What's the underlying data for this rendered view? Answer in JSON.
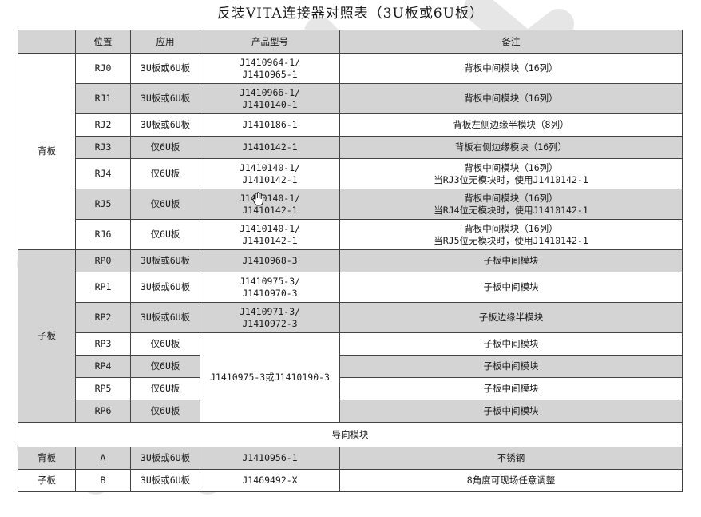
{
  "title": "反装VITA连接器对照表（3U板或6U板）",
  "headers": {
    "group": "",
    "pos": "位置",
    "app": "应用",
    "model": "产品型号",
    "note": "备注"
  },
  "groups": {
    "back": "背板",
    "daughter": "子板"
  },
  "rows": [
    {
      "pos": "RJ0",
      "app": "3U板或6U板",
      "model1": "J1410964-1/",
      "model2": "J1410965-1",
      "note1": "背板中间模块（16列）",
      "note2": ""
    },
    {
      "pos": "RJ1",
      "app": "3U板或6U板",
      "model1": "J1410966-1/",
      "model2": "J1410140-1",
      "note1": "背板中间模块（16列）",
      "note2": ""
    },
    {
      "pos": "RJ2",
      "app": "3U板或6U板",
      "model1": "J1410186-1",
      "model2": "",
      "note1": "背板左侧边缘半模块（8列）",
      "note2": ""
    },
    {
      "pos": "RJ3",
      "app": "仅6U板",
      "model1": "J1410142-1",
      "model2": "",
      "note1": "背板右侧边缘模块（16列）",
      "note2": ""
    },
    {
      "pos": "RJ4",
      "app": "仅6U板",
      "model1": "J1410140-1/",
      "model2": "J1410142-1",
      "note1": "背板中间模块（16列）",
      "note2": "当RJ3位无模块时，使用J1410142-1"
    },
    {
      "pos": "RJ5",
      "app": "仅6U板",
      "model1": "J1410140-1/",
      "model2": "J1410142-1",
      "note1": "背板中间模块（16列）",
      "note2": "当RJ4位无模块时，使用J1410142-1"
    },
    {
      "pos": "RJ6",
      "app": "仅6U板",
      "model1": "J1410140-1/",
      "model2": "J1410142-1",
      "note1": "背板中间模块（16列）",
      "note2": "当RJ5位无模块时，使用J1410142-1"
    },
    {
      "pos": "RP0",
      "app": "3U板或6U板",
      "model1": "J1410968-3",
      "model2": "",
      "note1": "子板中间模块",
      "note2": ""
    },
    {
      "pos": "RP1",
      "app": "3U板或6U板",
      "model1": "J1410975-3/",
      "model2": "J1410970-3",
      "note1": "子板中间模块",
      "note2": ""
    },
    {
      "pos": "RP2",
      "app": "3U板或6U板",
      "model1": "J1410971-3/",
      "model2": "J1410972-3",
      "note1": "子板边缘半模块",
      "note2": ""
    },
    {
      "pos": "RP3",
      "app": "仅6U板",
      "note1": "子板中间模块"
    },
    {
      "pos": "RP4",
      "app": "仅6U板",
      "note1": "子板中间模块"
    },
    {
      "pos": "RP5",
      "app": "仅6U板",
      "note1": "子板中间模块"
    },
    {
      "pos": "RP6",
      "app": "仅6U板",
      "note1": "子板中间模块"
    }
  ],
  "merged_model": "J1410975-3或J1410190-3",
  "guide_section": "导向模块",
  "guide_rows": [
    {
      "group": "背板",
      "pos": "A",
      "app": "3U板或6U板",
      "model": "J1410956-1",
      "note": "不锈钢"
    },
    {
      "group": "子板",
      "pos": "B",
      "app": "3U板或6U板",
      "model": "J1469492-X",
      "note": "8角度可现场任意调整"
    }
  ]
}
